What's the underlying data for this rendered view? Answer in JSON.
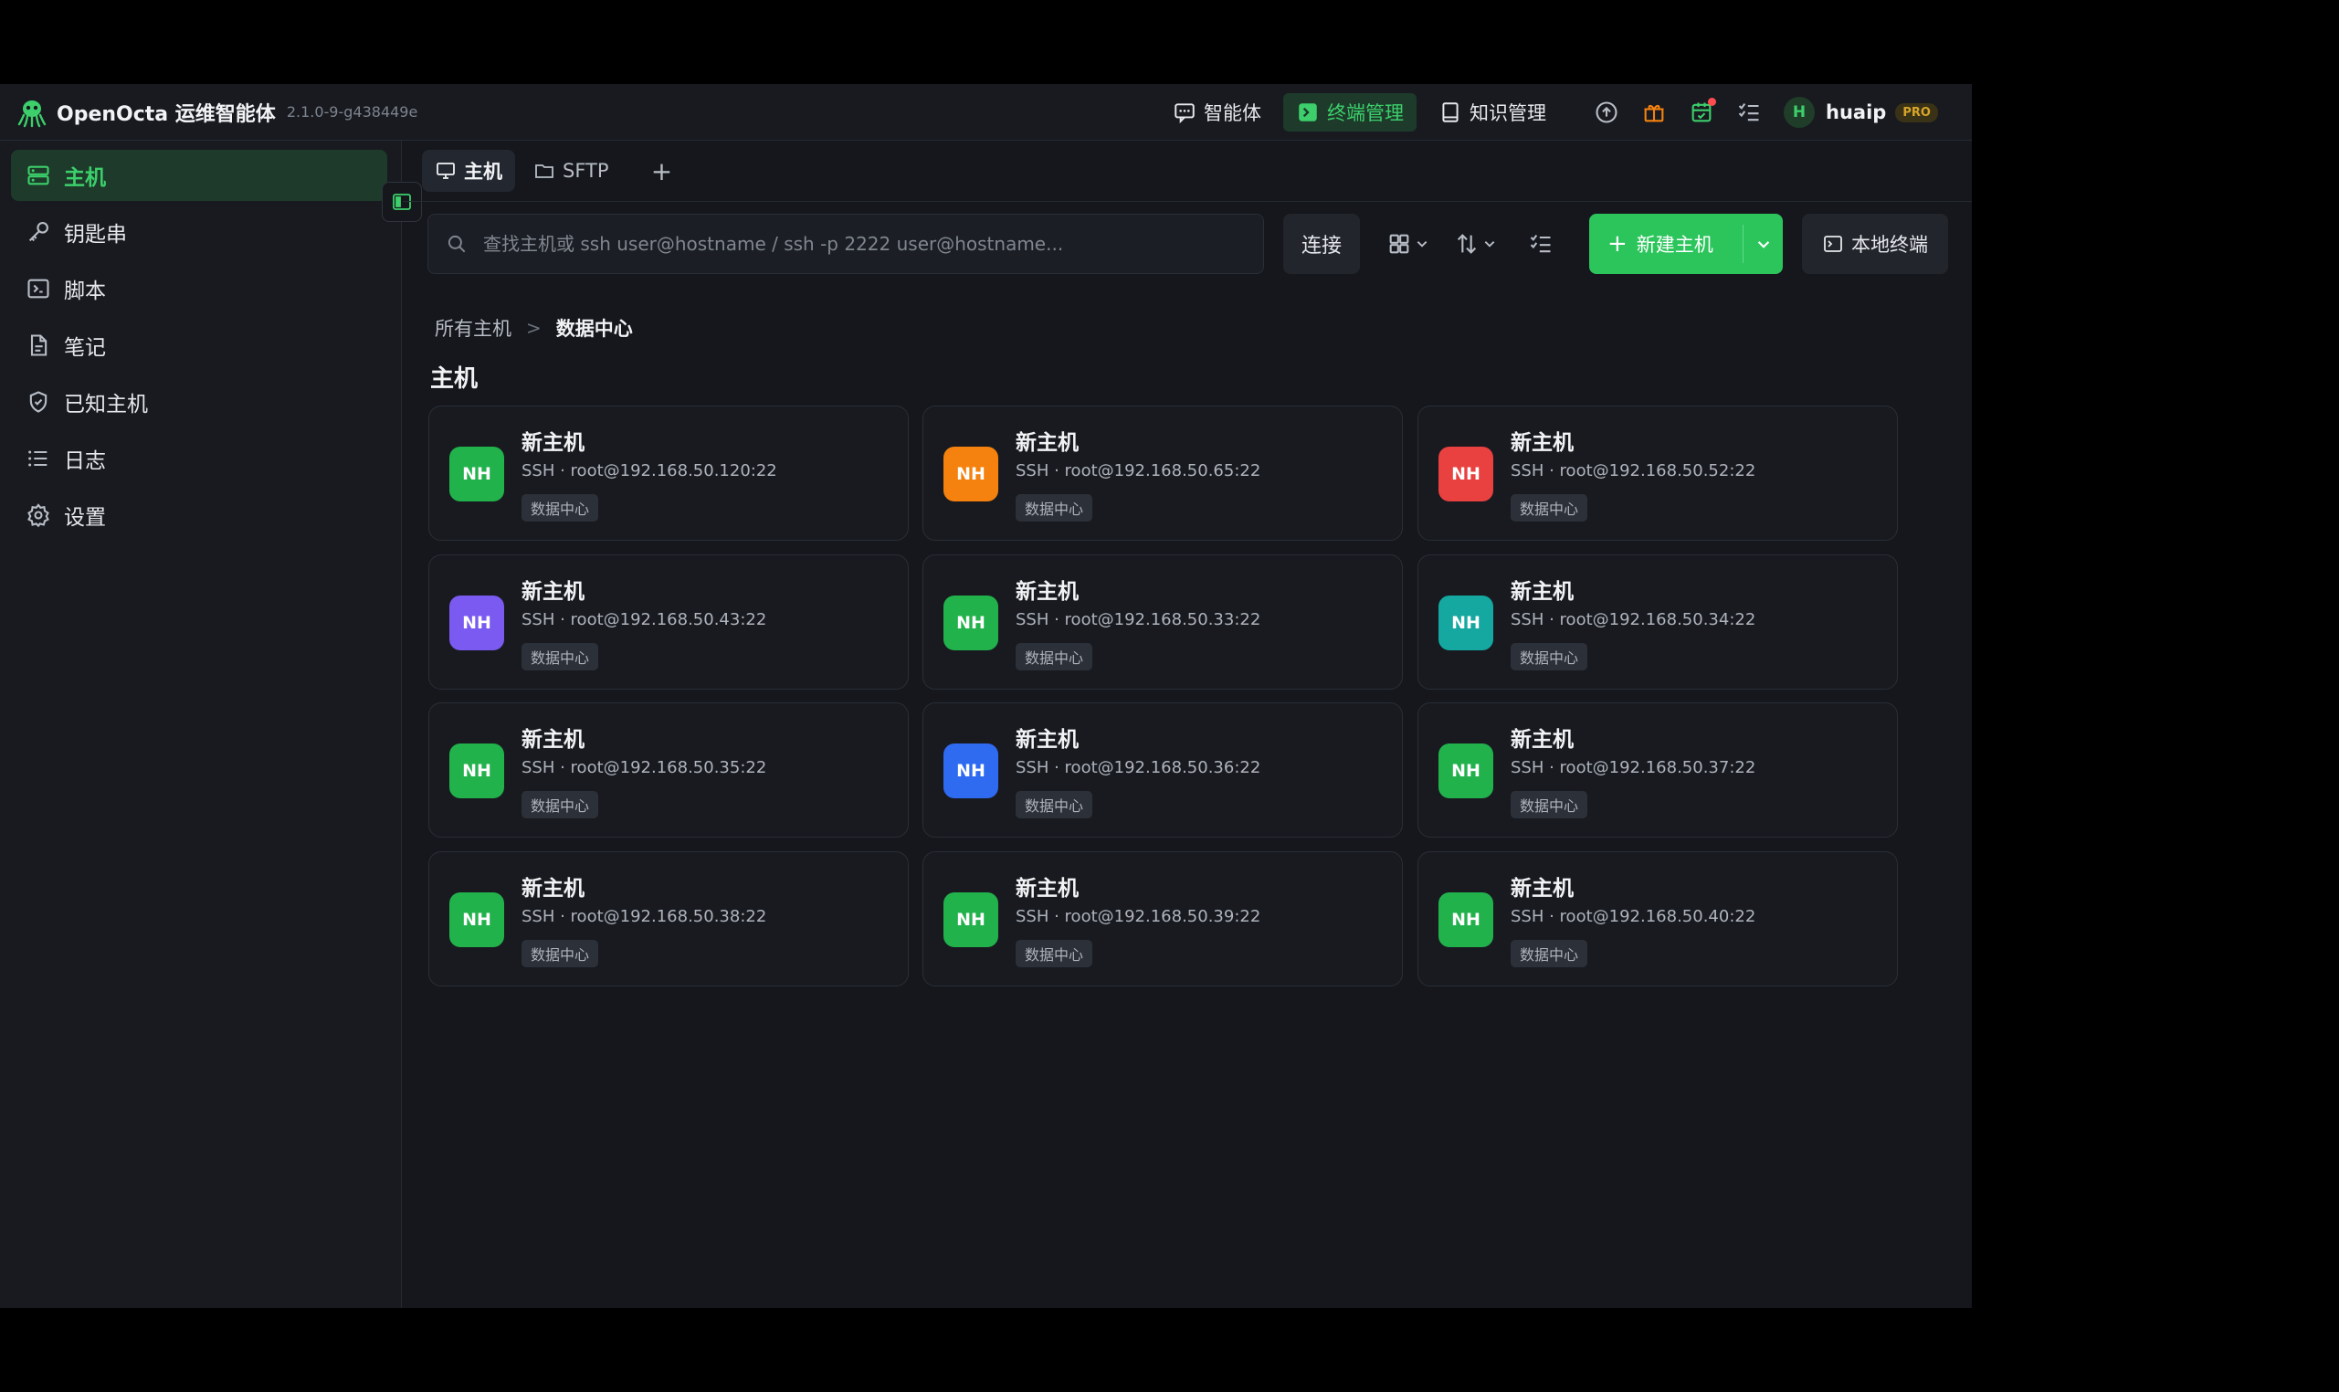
{
  "app": {
    "name": "OpenOcta 运维智能体",
    "version": "2.1.0-9-g438449e"
  },
  "topnav": [
    {
      "label": "智能体",
      "icon": "chat-icon",
      "active": false
    },
    {
      "label": "终端管理",
      "icon": "terminal-icon",
      "active": true
    },
    {
      "label": "知识管理",
      "icon": "book-icon",
      "active": false
    }
  ],
  "user": {
    "initial": "H",
    "name": "huaip",
    "badge": "PRO"
  },
  "sidebar": {
    "items": [
      {
        "label": "主机",
        "icon": "server-icon",
        "active": true
      },
      {
        "label": "钥匙串",
        "icon": "key-icon",
        "active": false
      },
      {
        "label": "脚本",
        "icon": "script-icon",
        "active": false
      },
      {
        "label": "笔记",
        "icon": "note-icon",
        "active": false
      },
      {
        "label": "已知主机",
        "icon": "shield-icon",
        "active": false
      },
      {
        "label": "日志",
        "icon": "list-icon",
        "active": false
      },
      {
        "label": "设置",
        "icon": "gear-icon",
        "active": false
      }
    ]
  },
  "tabs": [
    {
      "label": "主机",
      "icon": "monitor-icon",
      "active": true
    },
    {
      "label": "SFTP",
      "icon": "folder-icon",
      "active": false
    }
  ],
  "tab_add": "+",
  "toolbar": {
    "search_placeholder": "查找主机或 ssh user@hostname / ssh -p 2222 user@hostname...",
    "connect_label": "连接",
    "new_host_label": "新建主机",
    "local_terminal_label": "本地终端"
  },
  "breadcrumb": {
    "root": "所有主机",
    "sep": ">",
    "current": "数据中心"
  },
  "section_title": "主机",
  "hosts": [
    {
      "initials": "NH",
      "name": "新主机",
      "addr": "SSH · root@192.168.50.120:22",
      "tag": "数据中心",
      "color": "#22b24c"
    },
    {
      "initials": "NH",
      "name": "新主机",
      "addr": "SSH · root@192.168.50.65:22",
      "tag": "数据中心",
      "color": "#f5820f"
    },
    {
      "initials": "NH",
      "name": "新主机",
      "addr": "SSH · root@192.168.50.52:22",
      "tag": "数据中心",
      "color": "#e9413f"
    },
    {
      "initials": "NH",
      "name": "新主机",
      "addr": "SSH · root@192.168.50.43:22",
      "tag": "数据中心",
      "color": "#7a5af0"
    },
    {
      "initials": "NH",
      "name": "新主机",
      "addr": "SSH · root@192.168.50.33:22",
      "tag": "数据中心",
      "color": "#22b24c"
    },
    {
      "initials": "NH",
      "name": "新主机",
      "addr": "SSH · root@192.168.50.34:22",
      "tag": "数据中心",
      "color": "#14a8a0"
    },
    {
      "initials": "NH",
      "name": "新主机",
      "addr": "SSH · root@192.168.50.35:22",
      "tag": "数据中心",
      "color": "#22b24c"
    },
    {
      "initials": "NH",
      "name": "新主机",
      "addr": "SSH · root@192.168.50.36:22",
      "tag": "数据中心",
      "color": "#2f6bf0"
    },
    {
      "initials": "NH",
      "name": "新主机",
      "addr": "SSH · root@192.168.50.37:22",
      "tag": "数据中心",
      "color": "#22b24c"
    },
    {
      "initials": "NH",
      "name": "新主机",
      "addr": "SSH · root@192.168.50.38:22",
      "tag": "数据中心",
      "color": "#22b24c"
    },
    {
      "initials": "NH",
      "name": "新主机",
      "addr": "SSH · root@192.168.50.39:22",
      "tag": "数据中心",
      "color": "#22b24c"
    },
    {
      "initials": "NH",
      "name": "新主机",
      "addr": "SSH · root@192.168.50.40:22",
      "tag": "数据中心",
      "color": "#22b24c"
    }
  ],
  "colors": {
    "accent": "#2cc55c",
    "background": "#15171c",
    "sidebar": "#181a20"
  }
}
